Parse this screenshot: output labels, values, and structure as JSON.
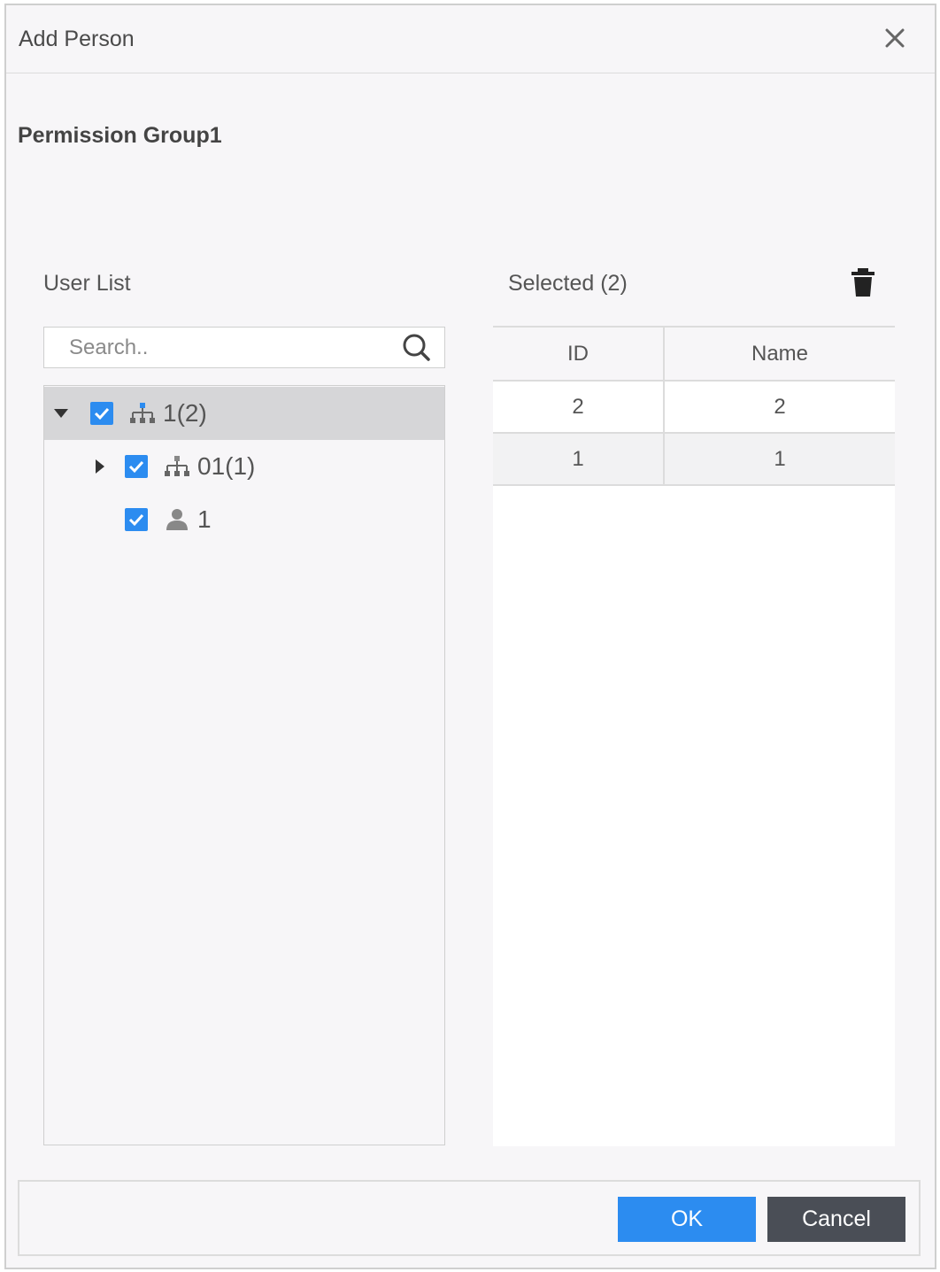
{
  "dialog": {
    "title": "Add Person",
    "close_icon": "close-icon"
  },
  "permission_group": "Permission Group1",
  "user_list": {
    "label": "User List",
    "search_placeholder": "Search..",
    "tree": [
      {
        "label": "1(2)",
        "icon": "org-tree-icon",
        "expander": "expanded",
        "checked": true,
        "selected": true
      },
      {
        "label": "01(1)",
        "icon": "org-tree-icon",
        "expander": "collapsed",
        "checked": true,
        "selected": false
      },
      {
        "label": "1",
        "icon": "person-icon",
        "expander": "none",
        "checked": true,
        "selected": false
      }
    ]
  },
  "selected_panel": {
    "label": "Selected (2)",
    "delete_icon": "trash-icon",
    "columns": [
      "ID",
      "Name"
    ],
    "rows": [
      {
        "id": "2",
        "name": "2"
      },
      {
        "id": "1",
        "name": "1"
      }
    ]
  },
  "footer": {
    "ok_label": "OK",
    "cancel_label": "Cancel"
  },
  "colors": {
    "accent": "#2c8cf0",
    "cancel": "#4a4e56",
    "selected_row": "#d6d6d8"
  }
}
